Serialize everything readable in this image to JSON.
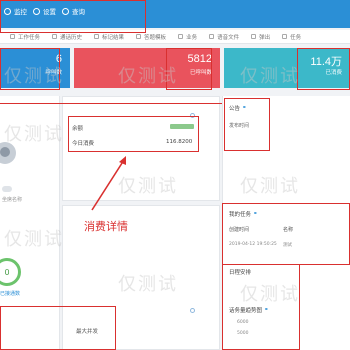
{
  "topnav": {
    "items": [
      {
        "label": "监控",
        "icon": "monitor-icon"
      },
      {
        "label": "设置",
        "icon": "gear-icon"
      },
      {
        "label": "查询",
        "icon": "search-icon"
      }
    ]
  },
  "toolbar": {
    "items": [
      "工作任务",
      "通话历史",
      "标记结果",
      "答题模板",
      "业务",
      "语音文件",
      "弹出",
      "任务"
    ]
  },
  "cards": [
    {
      "number": "6",
      "label": "呼叫数",
      "color": "#2b8fd6"
    },
    {
      "number": "5812",
      "label": "已呼叫数",
      "color": "#e9535d"
    },
    {
      "number": "11.4万",
      "label": "已消费",
      "color": "#3cb8c9"
    }
  ],
  "consumption": {
    "header": "余额",
    "today_label": "今日消费",
    "today_value": "116.8200"
  },
  "annotation": {
    "text": "消费详情"
  },
  "notice": {
    "title": "公告",
    "item": "发布时间"
  },
  "profile": {
    "name_label": "坐席名称",
    "ring_value": "0",
    "ring_caption": "已接通数"
  },
  "bottom": {
    "label": "最大并发"
  },
  "tasks": {
    "title": "我的任务",
    "columns": [
      "创建时间",
      "名称"
    ],
    "row": {
      "time": "2019-04-12 19:50:25",
      "name": "测试"
    }
  },
  "schedule": {
    "title": "日程安排"
  },
  "chart": {
    "title": "话务量趋势图",
    "ticks": [
      "6000",
      "5000"
    ]
  },
  "watermark": "仅测试"
}
